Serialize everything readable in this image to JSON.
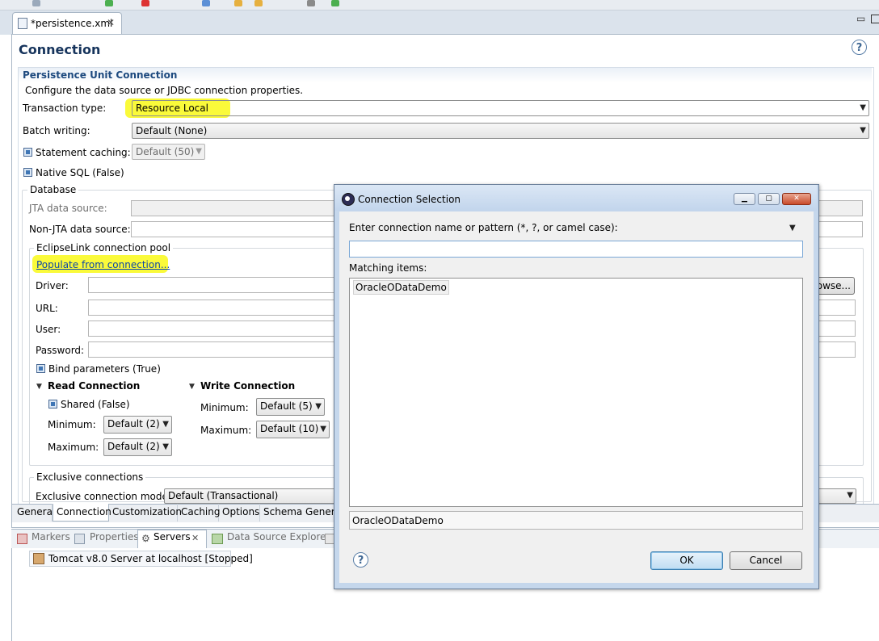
{
  "editor": {
    "tab_title": "*persistence.xml",
    "page_title": "Connection",
    "section_title": "Persistence Unit Connection",
    "section_description": "Configure the data source or JDBC connection properties.",
    "transaction_type_label": "Transaction type:",
    "transaction_type_value": "Resource Local",
    "batch_writing_label": "Batch writing:",
    "batch_writing_value": "Default (None)",
    "statement_caching_label": "Statement caching:",
    "statement_caching_value": "Default (50)",
    "native_sql_label": "Native SQL (False)",
    "database_group": "Database",
    "jta_label": "JTA data source:",
    "non_jta_label": "Non-JTA data source:",
    "pool_group": "EclipseLink connection pool",
    "populate_link": "Populate from connection...",
    "driver_label": "Driver:",
    "browse_label": "rowse...",
    "url_label": "URL:",
    "user_label": "User:",
    "password_label": "Password:",
    "bind_params_label": "Bind parameters (True)",
    "read_connection": "Read Connection",
    "shared_label": "Shared (False)",
    "read_min_label": "Minimum:",
    "read_min_value": "Default (2)",
    "read_max_label": "Maximum:",
    "read_max_value": "Default (2)",
    "write_connection": "Write Connection",
    "write_min_label": "Minimum:",
    "write_min_value": "Default (5)",
    "write_max_label": "Maximum:",
    "write_max_value": "Default (10)",
    "exclusive_group": "Exclusive connections",
    "exclusive_mode_label": "Exclusive connection mode:",
    "exclusive_mode_value": "Default (Transactional)",
    "help_glyph": "?"
  },
  "bottom_tabs": [
    "General",
    "Connection",
    "Customization",
    "Caching",
    "Options",
    "Schema Generat"
  ],
  "views": {
    "tabs": [
      "Markers",
      "Properties",
      "Servers",
      "Data Source Explorer"
    ],
    "server_entry": "Tomcat v8.0 Server at localhost  [Stopped]"
  },
  "dialog": {
    "title": "Connection Selection",
    "prompt": "Enter connection name or pattern (*, ?, or camel case):",
    "search_value": "",
    "matching_label": "Matching items:",
    "items": [
      "OracleODataDemo"
    ],
    "status": "OracleODataDemo",
    "ok": "OK",
    "cancel": "Cancel",
    "help_glyph": "?"
  },
  "colors": {
    "highlight": "#fafa3a",
    "section_title": "#1e4a7f",
    "link": "#0b46a8"
  }
}
